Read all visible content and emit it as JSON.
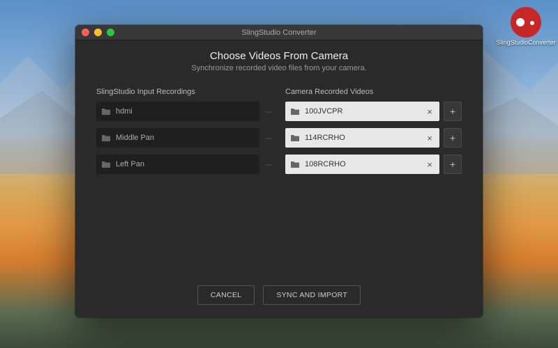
{
  "desktopIcon": {
    "label": "SlingStudioConverter"
  },
  "window": {
    "title": "SlingStudio Converter",
    "heading": "Choose Videos From Camera",
    "subheading": "Synchronize recorded video files from your camera.",
    "leftColumnTitle": "SlingStudio Input Recordings",
    "rightColumnTitle": "Camera Recorded Videos",
    "rows": [
      {
        "left": "hdmi",
        "right": "100JVCPR"
      },
      {
        "left": "Middle Pan",
        "right": "114RCRHO"
      },
      {
        "left": "Left Pan",
        "right": "108RCRHO"
      }
    ],
    "separator": "---",
    "clearGlyph": "×",
    "addGlyph": "+",
    "cancelLabel": "CANCEL",
    "syncLabel": "SYNC AND IMPORT"
  }
}
